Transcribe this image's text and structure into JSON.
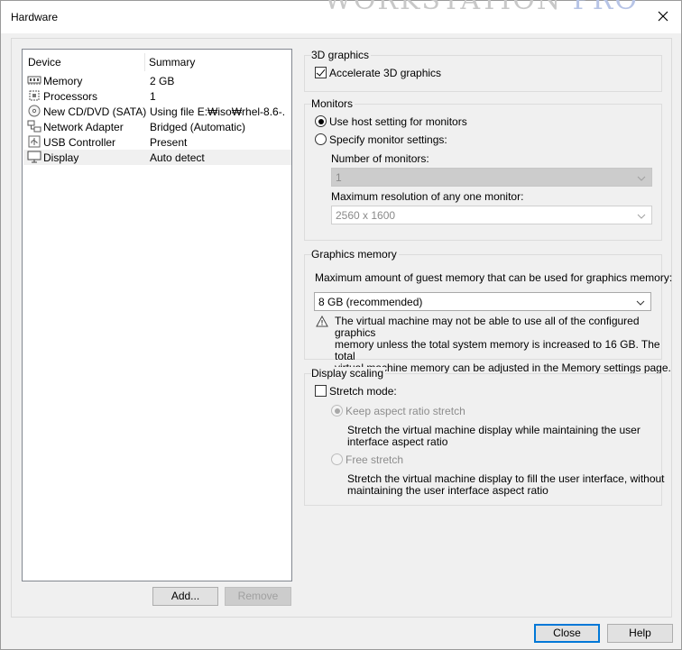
{
  "window": {
    "title": "Hardware"
  },
  "background_text": {
    "part1": "WORKSTATION ",
    "part2": "PRO"
  },
  "device_list": {
    "headers": {
      "device": "Device",
      "summary": "Summary"
    },
    "rows": [
      {
        "device": "Memory",
        "summary": "2 GB",
        "icon": "memory-icon"
      },
      {
        "device": "Processors",
        "summary": "1",
        "icon": "processor-icon"
      },
      {
        "device": "New CD/DVD (SATA)",
        "summary": "Using file E:₩iso₩rhel-8.6-...",
        "icon": "cd-dvd-icon"
      },
      {
        "device": "Network Adapter",
        "summary": "Bridged (Automatic)",
        "icon": "network-icon"
      },
      {
        "device": "USB Controller",
        "summary": "Present",
        "icon": "usb-icon"
      },
      {
        "device": "Display",
        "summary": "Auto detect",
        "icon": "display-icon"
      }
    ],
    "selected": "Display"
  },
  "buttons": {
    "add": "Add...",
    "remove": "Remove",
    "close": "Close",
    "help": "Help"
  },
  "graphics3d": {
    "title": "3D graphics",
    "accelerate_label": "Accelerate 3D graphics",
    "accelerate_checked": true
  },
  "monitors": {
    "title": "Monitors",
    "use_host_label": "Use host setting for monitors",
    "specify_label": "Specify monitor settings:",
    "selected": "use_host",
    "number_label": "Number of monitors:",
    "number_value": "1",
    "resolution_label": "Maximum resolution of any one monitor:",
    "resolution_value": "2560 x 1600"
  },
  "graphics_memory": {
    "title": "Graphics memory",
    "prompt": "Maximum amount of guest memory that can be used for graphics memory:",
    "value": "8 GB (recommended)",
    "warning_line1": "The virtual machine may not be able to use all of the configured graphics",
    "warning_line2": "memory unless the total system memory is increased to 16 GB. The total",
    "warning_line3": "virtual machine memory can be adjusted in the Memory settings page."
  },
  "display_scaling": {
    "title": "Display scaling",
    "stretch_label": "Stretch mode:",
    "stretch_checked": false,
    "keep_aspect_label": "Keep aspect ratio stretch",
    "keep_aspect_desc1": "Stretch the virtual machine display while maintaining the user",
    "keep_aspect_desc2": "interface aspect ratio",
    "free_label": "Free stretch",
    "free_desc1": "Stretch the virtual machine display to fill the user interface, without",
    "free_desc2": "maintaining the user interface aspect ratio"
  }
}
